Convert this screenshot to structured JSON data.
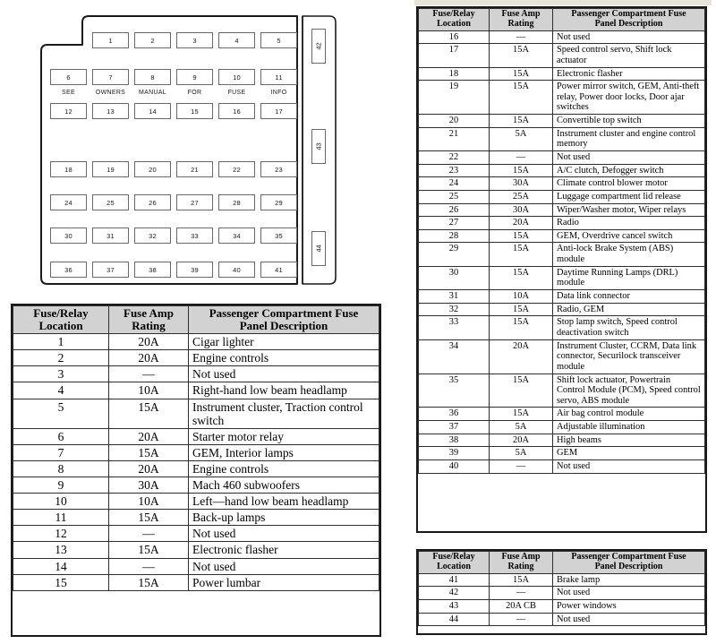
{
  "diagram": {
    "name": "passenger-compartment-fuse-panel-diagram",
    "legend_words": [
      "SEE",
      "OWNERS",
      "MANUAL",
      "FOR",
      "FUSE",
      "INFO"
    ],
    "rows": [
      {
        "row": 1,
        "offset": true,
        "cells": [
          "1",
          "2",
          "3",
          "4",
          "5"
        ]
      },
      {
        "row": 2,
        "offset": false,
        "cells": [
          "6",
          "7",
          "8",
          "9",
          "10",
          "11"
        ]
      },
      {
        "row": 3,
        "offset": false,
        "cells": [
          "12",
          "13",
          "14",
          "15",
          "16",
          "17"
        ]
      },
      {
        "row": 4,
        "offset": false,
        "cells": [
          "18",
          "19",
          "20",
          "21",
          "22",
          "23"
        ]
      },
      {
        "row": 5,
        "offset": false,
        "cells": [
          "24",
          "25",
          "26",
          "27",
          "28",
          "29"
        ]
      },
      {
        "row": 6,
        "offset": false,
        "cells": [
          "30",
          "31",
          "32",
          "33",
          "34",
          "35"
        ]
      },
      {
        "row": 7,
        "offset": false,
        "cells": [
          "36",
          "37",
          "38",
          "39",
          "40",
          "41"
        ]
      }
    ],
    "side_cells": [
      "42",
      "43",
      "44"
    ]
  },
  "headers": {
    "location": "Fuse/Relay Location",
    "location_line1": "Fuse/Relay",
    "location_line2": "Location",
    "rating": "Fuse Amp Rating",
    "rating_line1": "Fuse Amp",
    "rating_line2": "Rating",
    "description": "Passenger Compartment Fuse Panel Description",
    "description_line1": "Passenger Compartment Fuse",
    "description_line2": "Panel Description"
  },
  "colors": {
    "header_bg": "#d2d2d2",
    "border": "#2e2e2e",
    "frame": "#1a1a1a",
    "page_bg": "#ffffff",
    "top_strip": "#e8e4d8"
  },
  "table_left": {
    "name": "fuse-table-1-15",
    "rows": [
      {
        "location": "1",
        "rating": "20A",
        "description": "Cigar lighter"
      },
      {
        "location": "2",
        "rating": "20A",
        "description": "Engine controls"
      },
      {
        "location": "3",
        "rating": "—",
        "description": "Not used"
      },
      {
        "location": "4",
        "rating": "10A",
        "description": "Right-hand low beam headlamp"
      },
      {
        "location": "5",
        "rating": "15A",
        "description": "Instrument cluster, Traction control switch"
      },
      {
        "location": "6",
        "rating": "20A",
        "description": "Starter motor relay"
      },
      {
        "location": "7",
        "rating": "15A",
        "description": "GEM, Interior lamps"
      },
      {
        "location": "8",
        "rating": "20A",
        "description": "Engine controls"
      },
      {
        "location": "9",
        "rating": "30A",
        "description": "Mach 460 subwoofers"
      },
      {
        "location": "10",
        "rating": "10A",
        "description": "Left—hand low beam headlamp"
      },
      {
        "location": "11",
        "rating": "15A",
        "description": "Back-up lamps"
      },
      {
        "location": "12",
        "rating": "—",
        "description": "Not used"
      },
      {
        "location": "13",
        "rating": "15A",
        "description": "Electronic flasher"
      },
      {
        "location": "14",
        "rating": "—",
        "description": "Not used"
      },
      {
        "location": "15",
        "rating": "15A",
        "description": "Power lumbar"
      }
    ]
  },
  "table_right": {
    "name": "fuse-table-16-40",
    "rows": [
      {
        "location": "16",
        "rating": "—",
        "description": "Not used"
      },
      {
        "location": "17",
        "rating": "15A",
        "description": "Speed control servo, Shift lock actuator"
      },
      {
        "location": "18",
        "rating": "15A",
        "description": "Electronic flasher"
      },
      {
        "location": "19",
        "rating": "15A",
        "description": "Power mirror switch, GEM, Anti-theft relay, Power door locks, Door ajar switches"
      },
      {
        "location": "20",
        "rating": "15A",
        "description": "Convertible top switch"
      },
      {
        "location": "21",
        "rating": "5A",
        "description": "Instrument cluster and engine control memory"
      },
      {
        "location": "22",
        "rating": "—",
        "description": "Not used"
      },
      {
        "location": "23",
        "rating": "15A",
        "description": "A/C clutch, Defogger switch"
      },
      {
        "location": "24",
        "rating": "30A",
        "description": "Climate control blower motor"
      },
      {
        "location": "25",
        "rating": "25A",
        "description": "Luggage compartment lid release"
      },
      {
        "location": "26",
        "rating": "30A",
        "description": "Wiper/Washer motor, Wiper relays"
      },
      {
        "location": "27",
        "rating": "20A",
        "description": "Radio"
      },
      {
        "location": "28",
        "rating": "15A",
        "description": "GEM, Overdrive cancel switch"
      },
      {
        "location": "29",
        "rating": "15A",
        "description": "Anti-lock Brake System (ABS) module"
      },
      {
        "location": "30",
        "rating": "15A",
        "description": "Daytime Running Lamps (DRL) module"
      },
      {
        "location": "31",
        "rating": "10A",
        "description": "Data link connector"
      },
      {
        "location": "32",
        "rating": "15A",
        "description": "Radio, GEM"
      },
      {
        "location": "33",
        "rating": "15A",
        "description": "Stop lamp switch, Speed control deactivation switch"
      },
      {
        "location": "34",
        "rating": "20A",
        "description": "Instrument Cluster, CCRM, Data link connector, Securilock transceiver module"
      },
      {
        "location": "35",
        "rating": "15A",
        "description": "Shift lock actuator, Powertrain Control Module (PCM), Speed control servo, ABS module"
      },
      {
        "location": "36",
        "rating": "15A",
        "description": "Air bag control module"
      },
      {
        "location": "37",
        "rating": "5A",
        "description": "Adjustable illumination"
      },
      {
        "location": "38",
        "rating": "20A",
        "description": "High beams"
      },
      {
        "location": "39",
        "rating": "5A",
        "description": "GEM"
      },
      {
        "location": "40",
        "rating": "—",
        "description": "Not used"
      }
    ]
  },
  "table_bottom": {
    "name": "fuse-table-41-44",
    "rows": [
      {
        "location": "41",
        "rating": "15A",
        "description": "Brake lamp"
      },
      {
        "location": "42",
        "rating": "—",
        "description": "Not used"
      },
      {
        "location": "43",
        "rating": "20A CB",
        "description": "Power windows"
      },
      {
        "location": "44",
        "rating": "—",
        "description": "Not used"
      }
    ]
  }
}
